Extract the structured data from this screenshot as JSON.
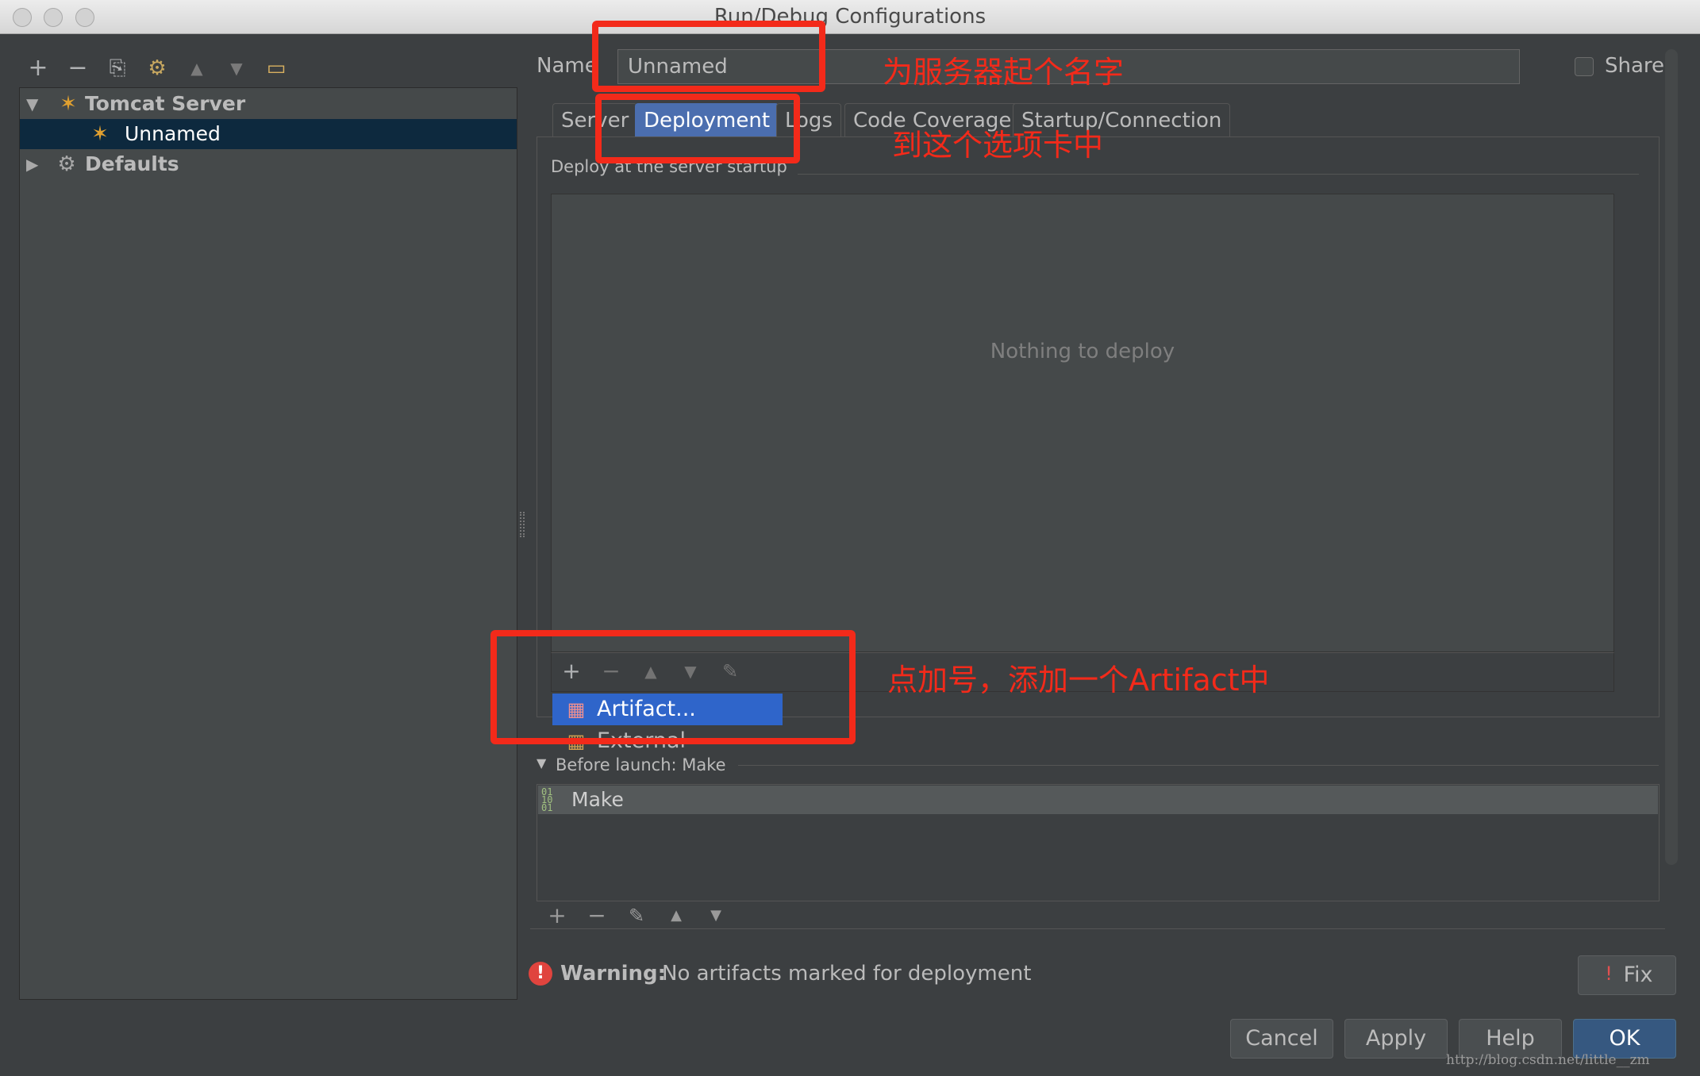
{
  "window": {
    "title": "Run/Debug Configurations"
  },
  "left_toolbar": {
    "icons": [
      "add-icon",
      "remove-icon",
      "copy-icon",
      "edit-defaults-icon",
      "move-up-icon",
      "move-down-icon",
      "folder-icon"
    ]
  },
  "tree": {
    "items": [
      {
        "label": "Tomcat Server",
        "expanded": true
      },
      {
        "label": "Unnamed",
        "selected": true
      },
      {
        "label": "Defaults",
        "expanded": false
      }
    ]
  },
  "name_field": {
    "label": "Name",
    "value": "Unnamed"
  },
  "share": {
    "label": "Share",
    "checked": false
  },
  "tabs": [
    {
      "label": "Server"
    },
    {
      "label": "Deployment",
      "active": true
    },
    {
      "label": "Logs"
    },
    {
      "label": "Code Coverage"
    },
    {
      "label": "Startup/Connection"
    }
  ],
  "deployment": {
    "section_title": "Deploy at the server startup",
    "empty_text": "Nothing to deploy",
    "popup_items": [
      "Artifact...",
      "External Source..."
    ]
  },
  "before_launch": {
    "title": "Before launch: Make",
    "items": [
      "Make"
    ]
  },
  "warning": {
    "bold": "Warning:",
    "text": "No artifacts marked for deployment"
  },
  "buttons": {
    "fix": "Fix",
    "cancel": "Cancel",
    "apply": "Apply",
    "help": "Help",
    "ok": "OK"
  },
  "annotations": {
    "name_note": "为服务器起个名字",
    "tab_note": "到这个选项卡中",
    "add_note": "点加号，添加一个Artifact中"
  },
  "watermark": "http://blog.csdn.net/little__zm",
  "colors": {
    "annotation_red": "#f32a1a",
    "selection_blue": "#2f65ca",
    "active_tab": "#4b6eaf"
  }
}
